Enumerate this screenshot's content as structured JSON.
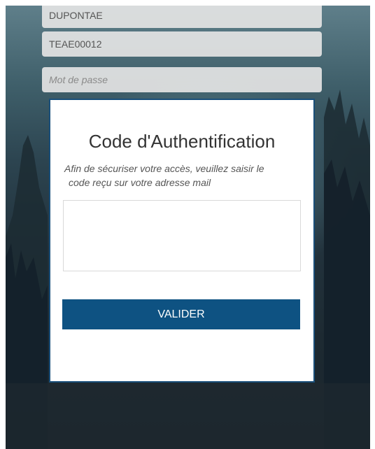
{
  "login_form": {
    "username_value": "DUPONTAE",
    "code_value": "TEAE00012",
    "password_placeholder": "Mot de passe"
  },
  "auth_modal": {
    "title": "Code d'Authentification",
    "instruction_line1": "Afin de sécuriser votre accès, veuillez saisir le",
    "instruction_line2": "code reçu sur votre adresse mail",
    "code_input_value": "",
    "submit_label": "VALIDER"
  },
  "colors": {
    "primary_button": "#0e5282",
    "modal_border": "#1a4f7a"
  }
}
